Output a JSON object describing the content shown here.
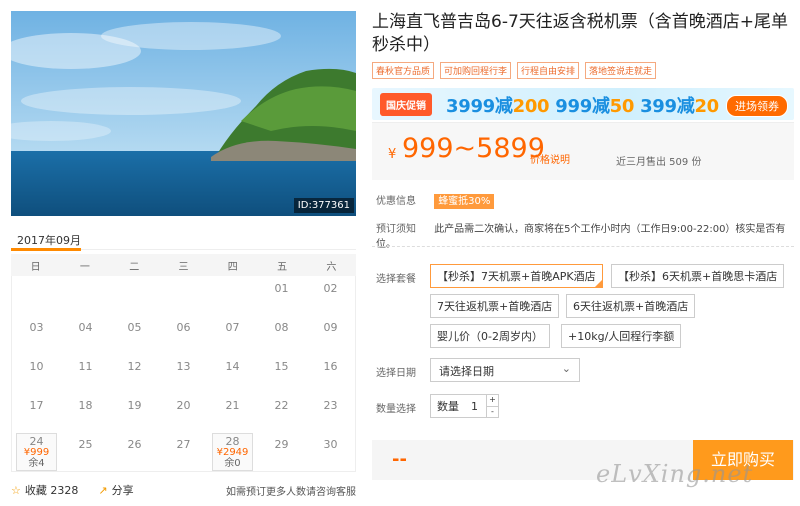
{
  "photo": {
    "id_label": "ID:377361"
  },
  "calendar": {
    "month": "2017年09月",
    "weekdays": [
      "日",
      "一",
      "二",
      "三",
      "四",
      "五",
      "六"
    ],
    "row1": [
      "",
      "",
      "",
      "",
      "",
      "01",
      "02"
    ],
    "row2": [
      "03",
      "04",
      "05",
      "06",
      "07",
      "08",
      "09"
    ],
    "row3": [
      "10",
      "11",
      "12",
      "13",
      "14",
      "15",
      "16"
    ],
    "row4": [
      "17",
      "18",
      "19",
      "20",
      "21",
      "22",
      "23"
    ],
    "row5": {
      "d24": "24",
      "p24": "¥999",
      "s24": "余4",
      "d25": "25",
      "d26": "26",
      "d27": "27",
      "d28": "28",
      "p28": "¥2949",
      "s28": "余0",
      "d29": "29",
      "d30": "30"
    }
  },
  "bottom": {
    "fav_label": "收藏",
    "fav_count": "2328",
    "share_label": "分享",
    "note": "如需预订更多人数请咨询客服"
  },
  "product": {
    "title": "上海直飞普吉岛6-7天往返含税机票（含首晚酒店+尾单秒杀中）",
    "tags": [
      "春秋官方品质",
      "可加购回程行李",
      "行程自由安排",
      "落地签说走就走"
    ]
  },
  "banner": {
    "badge": "国庆促销",
    "deal1_a": "3999减",
    "deal1_b": "200",
    "deal2_a": "999减",
    "deal2_b": "50",
    "deal3_a": "399减",
    "deal3_b": "20",
    "cta": "进场领券"
  },
  "price": {
    "currency": "¥",
    "range": "999~5899",
    "explain": "价格说明",
    "sold": "近三月售出 509 份"
  },
  "info": {
    "discount_label": "优惠信息",
    "discount_value": "蜂蜜抵30%",
    "notice_label": "预订须知",
    "notice_text": "此产品需二次确认，商家将在5个工作小时内（工作日9:00-22:00）核实是否有位。"
  },
  "packages": {
    "label": "选择套餐",
    "items": [
      "【秒杀】7天机票+首晚APK酒店",
      "【秒杀】6天机票+首晚思卡酒店",
      "7天往返机票+首晚酒店",
      "6天往返机票+首晚酒店",
      "婴儿价（0-2周岁内）",
      "+10kg/人回程行李额"
    ]
  },
  "date": {
    "label": "选择日期",
    "placeholder": "请选择日期"
  },
  "quantity": {
    "label": "数量选择",
    "prefix": "数量",
    "value": "1",
    "plus": "+",
    "minus": "-"
  },
  "buy": {
    "price_placeholder": "--",
    "button": "立即购买"
  },
  "watermark": "eLvXing.net",
  "colors": {
    "accent": "#ff9a1c",
    "price": "#ff6600",
    "banner_blue": "#1a8fe0"
  }
}
